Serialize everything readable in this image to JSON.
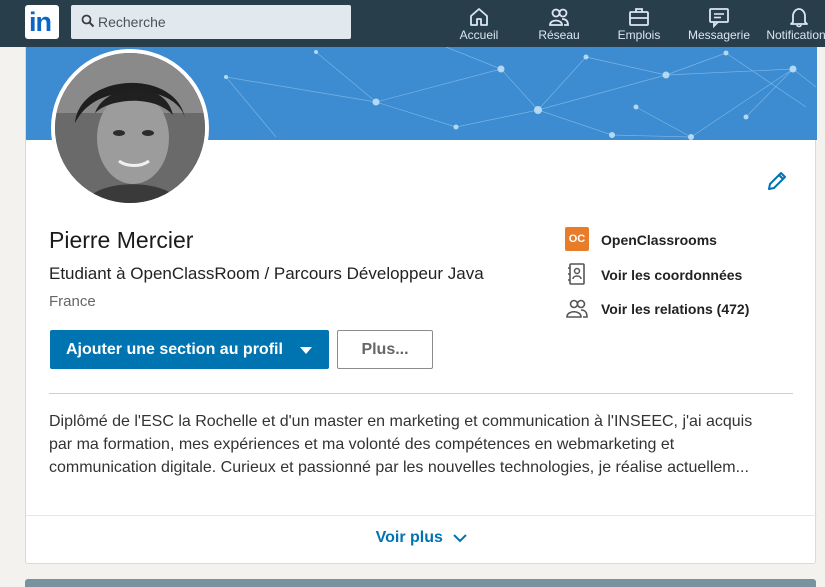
{
  "nav": {
    "logo_text": "in",
    "search_placeholder": "Recherche",
    "items": [
      {
        "label": "Accueil",
        "icon": "home-icon"
      },
      {
        "label": "Réseau",
        "icon": "network-icon"
      },
      {
        "label": "Emplois",
        "icon": "briefcase-icon"
      },
      {
        "label": "Messagerie",
        "icon": "messaging-icon"
      },
      {
        "label": "Notifications",
        "icon": "bell-icon"
      }
    ]
  },
  "profile": {
    "name": "Pierre Mercier",
    "headline": "Etudiant à OpenClassRoom / Parcours Développeur Java",
    "location": "France",
    "add_section_label": "Ajouter une section au profil",
    "more_label": "Plus...",
    "side": {
      "company": "OpenClassrooms",
      "company_logo_text": "OC",
      "contact": "Voir les coordonnées",
      "connections": "Voir les relations (472)"
    },
    "summary_lines": [
      "Diplômé de l'ESC la Rochelle et d'un master en marketing et communication à l'INSEEC, j'ai acquis",
      "par ma formation, mes expériences et ma volonté des compétences en webmarketing et",
      "communication digitale. Curieux et passionné par les nouvelles technologies, je réalise actuellem..."
    ],
    "see_more_label": "Voir plus"
  },
  "colors": {
    "nav_bg": "#283e4a",
    "brand_blue": "#0073b1",
    "banner": "#3d8bd0",
    "oc_orange": "#e97c28"
  }
}
